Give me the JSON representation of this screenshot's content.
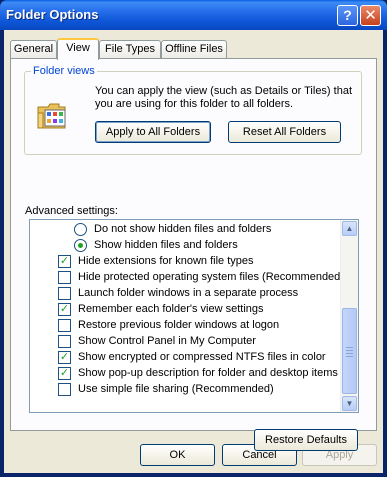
{
  "window": {
    "title": "Folder Options"
  },
  "tabs": [
    {
      "label": "General"
    },
    {
      "label": "View"
    },
    {
      "label": "File Types"
    },
    {
      "label": "Offline Files"
    }
  ],
  "folder_views": {
    "legend": "Folder views",
    "description": "You can apply the view (such as Details or Tiles) that you are using for this folder to all folders.",
    "apply_label": "Apply to All Folders",
    "reset_label": "Reset All Folders"
  },
  "advanced": {
    "label": "Advanced settings:",
    "items": [
      {
        "type": "radio",
        "checked": false,
        "label": "Do not show hidden files and folders"
      },
      {
        "type": "radio",
        "checked": true,
        "label": "Show hidden files and folders"
      },
      {
        "type": "checkbox",
        "checked": true,
        "label": "Hide extensions for known file types"
      },
      {
        "type": "checkbox",
        "checked": false,
        "label": "Hide protected operating system files (Recommended)"
      },
      {
        "type": "checkbox",
        "checked": false,
        "label": "Launch folder windows in a separate process"
      },
      {
        "type": "checkbox",
        "checked": true,
        "label": "Remember each folder's view settings"
      },
      {
        "type": "checkbox",
        "checked": false,
        "label": "Restore previous folder windows at logon"
      },
      {
        "type": "checkbox",
        "checked": false,
        "label": "Show Control Panel in My Computer"
      },
      {
        "type": "checkbox",
        "checked": true,
        "label": "Show encrypted or compressed NTFS files in color"
      },
      {
        "type": "checkbox",
        "checked": true,
        "label": "Show pop-up description for folder and desktop items"
      },
      {
        "type": "checkbox",
        "checked": false,
        "label": "Use simple file sharing (Recommended)"
      }
    ],
    "restore_label": "Restore Defaults"
  },
  "footer": {
    "ok_label": "OK",
    "cancel_label": "Cancel",
    "apply_label": "Apply"
  },
  "colors": {
    "title_bar": "#0b57d8",
    "dialog_bg": "#ece9d8",
    "legend_blue": "#0046d5",
    "check_green": "#21a121",
    "active_tab_accent": "#ffc83c"
  }
}
